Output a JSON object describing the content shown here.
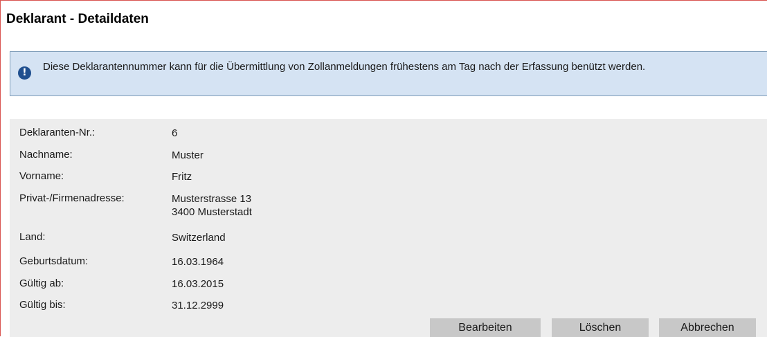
{
  "page": {
    "title": "Deklarant - Detaildaten"
  },
  "info": {
    "icon": "info-exclamation-icon",
    "message": "Diese Deklarantennummer kann für die Übermittlung von Zollanmeldungen frühestens am Tag nach der Erfassung benützt werden."
  },
  "details": {
    "declarant_no": {
      "label": "Deklaranten-Nr.:",
      "value": "6"
    },
    "lastname": {
      "label": "Nachname:",
      "value": "Muster"
    },
    "firstname": {
      "label": "Vorname:",
      "value": "Fritz"
    },
    "address": {
      "label": "Privat-/Firmenadresse:",
      "line1": "Musterstrasse 13",
      "line2": "3400 Musterstadt"
    },
    "country": {
      "label": "Land:",
      "value": "Switzerland"
    },
    "birthdate": {
      "label": "Geburtsdatum:",
      "value": "16.03.1964"
    },
    "valid_from": {
      "label": "Gültig ab:",
      "value": "16.03.2015"
    },
    "valid_to": {
      "label": "Gültig bis:",
      "value": "31.12.2999"
    }
  },
  "actions": {
    "edit_label": "Bearbeiten",
    "delete_label": "Löschen",
    "cancel_label": "Abbrechen"
  },
  "colors": {
    "info_background": "#d5e3f3",
    "info_border": "#7f9db9",
    "detail_background": "#ededed",
    "button_background": "#c8c8c8",
    "frame_border": "#d9534f"
  }
}
